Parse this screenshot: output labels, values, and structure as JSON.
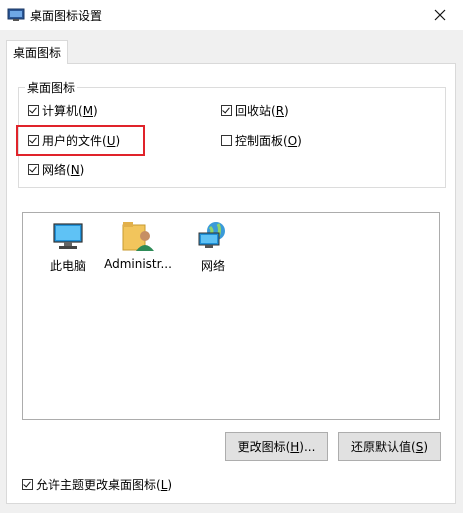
{
  "window": {
    "title": "桌面图标设置",
    "app_icon": "desktop-settings-icon",
    "close_icon": "close-icon"
  },
  "tabs": [
    {
      "label": "桌面图标",
      "selected": true
    }
  ],
  "group": {
    "label": "桌面图标",
    "checkboxes": {
      "computer": {
        "label": "计算机(",
        "key": "M",
        "suffix": ")",
        "checked": true
      },
      "recycle": {
        "label": "回收站(",
        "key": "R",
        "suffix": ")",
        "checked": true
      },
      "user_files": {
        "label": "用户的文件(",
        "key": "U",
        "suffix": ")",
        "checked": true
      },
      "control_panel": {
        "label": "控制面板(",
        "key": "O",
        "suffix": ")",
        "checked": false
      },
      "network": {
        "label": "网络(",
        "key": "N",
        "suffix": ")",
        "checked": true
      }
    }
  },
  "icon_list": [
    {
      "label": "此电脑",
      "icon": "computer-icon"
    },
    {
      "label": "Administr...",
      "icon": "user-folder-icon"
    },
    {
      "label": "网络",
      "icon": "network-icon"
    }
  ],
  "buttons": {
    "change_icon": {
      "label": "更改图标(",
      "key": "H",
      "suffix": ")..."
    },
    "restore_default": {
      "label": "还原默认值(",
      "key": "S",
      "suffix": ")"
    }
  },
  "allow_themes": {
    "label": "允许主题更改桌面图标(",
    "key": "L",
    "suffix": ")",
    "checked": true
  },
  "colors": {
    "highlight": "#e0232a",
    "tab_border": "#d9d9d9",
    "window_bg": "#f0f0f0"
  }
}
